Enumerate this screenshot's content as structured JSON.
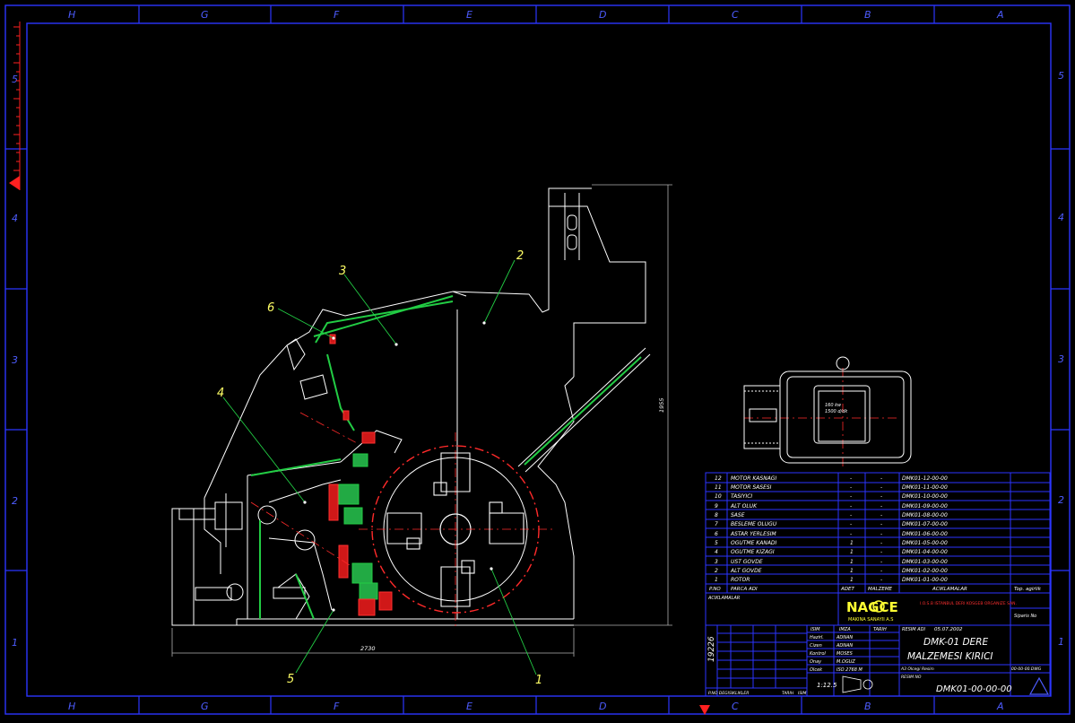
{
  "colors": {
    "background": "#000000",
    "frame": "#2b35ff",
    "outline": "#ffffff",
    "accent_yellow": "#ffff66",
    "part_green": "#22cc44",
    "part_red": "#ff2020",
    "centerline_red": "#ff2a2a",
    "dimension_gray": "#b0b0b0"
  },
  "border": {
    "top_letters": [
      "H",
      "G",
      "F",
      "E",
      "D",
      "C",
      "B",
      "A"
    ],
    "bottom_letters": [
      "H",
      "G",
      "F",
      "E",
      "D",
      "C",
      "B",
      "A"
    ],
    "left_numbers": [
      "5",
      "4",
      "3",
      "2",
      "1"
    ],
    "right_numbers": [
      "5",
      "4",
      "3",
      "2",
      "1"
    ]
  },
  "balloons": [
    "1",
    "2",
    "3",
    "4",
    "5",
    "6"
  ],
  "dimensions": {
    "width": "2730",
    "height": "1955"
  },
  "motor": {
    "label_line1": "160 kw",
    "label_line2": "1500 d/dk"
  },
  "parts_list": {
    "rows": [
      {
        "no": "12",
        "name": "MOTOR KASNAGI",
        "qty": "-",
        "mat": "-",
        "code": "DMK01-12-00-00"
      },
      {
        "no": "11",
        "name": "MOTOR SASESI",
        "qty": "-",
        "mat": "-",
        "code": "DMK01-11-00-00"
      },
      {
        "no": "10",
        "name": "TASIYICI",
        "qty": "-",
        "mat": "-",
        "code": "DMK01-10-00-00"
      },
      {
        "no": "9",
        "name": "ALT OLUK",
        "qty": "-",
        "mat": "-",
        "code": "DMK01-09-00-00"
      },
      {
        "no": "8",
        "name": "SASE",
        "qty": "-",
        "mat": "-",
        "code": "DMK01-08-00-00"
      },
      {
        "no": "7",
        "name": "BESLEME OLUGU",
        "qty": "-",
        "mat": "-",
        "code": "DMK01-07-00-00"
      },
      {
        "no": "6",
        "name": "ASTAR YERLESIM",
        "qty": "-",
        "mat": "-",
        "code": "DMK01-06-00-00"
      },
      {
        "no": "5",
        "name": "OGUTME KANADI",
        "qty": "1",
        "mat": "-",
        "code": "DMK01-05-00-00"
      },
      {
        "no": "4",
        "name": "OGUTME KIZAGI",
        "qty": "1",
        "mat": "-",
        "code": "DMK01-04-00-00"
      },
      {
        "no": "3",
        "name": "UST GOVDE",
        "qty": "1",
        "mat": "-",
        "code": "DMK01-03-00-00"
      },
      {
        "no": "2",
        "name": "ALT GOVDE",
        "qty": "1",
        "mat": "-",
        "code": "DMK01-02-00-00"
      },
      {
        "no": "1",
        "name": "ROTOR",
        "qty": "1",
        "mat": "-",
        "code": "DMK01-01-00-00"
      }
    ],
    "header": {
      "no": "P.NO",
      "name": "PARCA ADI",
      "qty": "ADET",
      "mat": "MALZEME",
      "notes": "ACIKLAMALAR",
      "side1": "Top. agirlik",
      "side2": "Siparis No"
    }
  },
  "title_block": {
    "notes_label": "ACIKLAMALAR",
    "company_logo": "NAGCE",
    "company_sub": "MAKINA SANAYII A.S",
    "company_address": "I.O.S.B ISTANBUL DERI KOSGEB ORGANIZE SAN.",
    "date_header_1": "ISIM",
    "date_header_2": "IMZA",
    "date_header_3": "TARIH",
    "date": "05.07.2002",
    "rows": [
      {
        "label": "Hazirl.",
        "value": "ADNAN"
      },
      {
        "label": "Cizen",
        "value": "ADNAN"
      },
      {
        "label": "Kontrol",
        "value": "MOSES"
      },
      {
        "label": "Onay",
        "value": "M.OGUZ"
      },
      {
        "label": "Olcek",
        "value": "ISO 2768 M"
      }
    ],
    "resim_adi_label": "RESIM ADI",
    "title_line1": "DMK-01  DERE",
    "title_line2": "MALZEMESI  KIRICI",
    "scale": "1:12.5",
    "vertical_number": "19226",
    "revision_label": "P.NO DEGISIKLIKLER",
    "revision_date": "TARIH",
    "revision_name": "ISIM",
    "file_label": "A3 Olcegi Resim",
    "file_name": "00-00-00.DWG",
    "drawing_no_label": "RESIM NO",
    "drawing_no": "DMK01-00-00-00"
  }
}
